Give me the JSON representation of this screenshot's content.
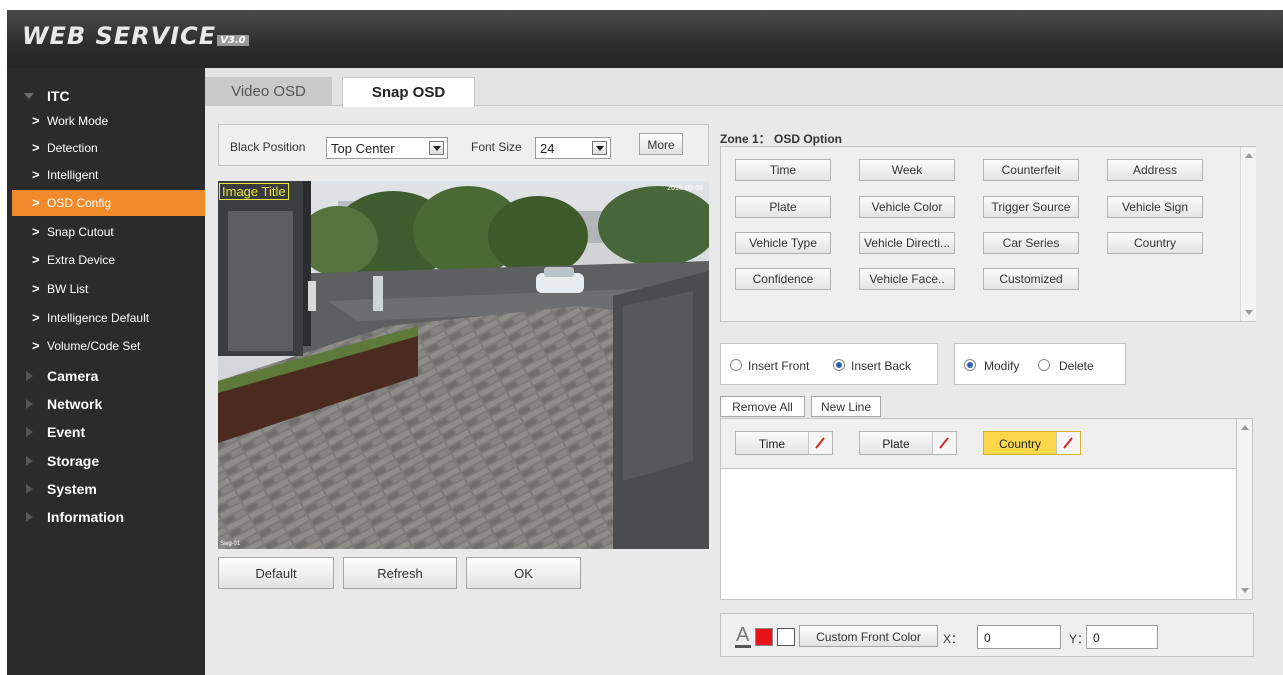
{
  "app": {
    "title": "WEB SERVICE",
    "version": "V3.0"
  },
  "sidebar": {
    "itc": {
      "label": "ITC"
    },
    "sub_items": [
      {
        "label": "Work Mode"
      },
      {
        "label": "Detection"
      },
      {
        "label": "Intelligent"
      },
      {
        "label": "OSD Config"
      },
      {
        "label": "Snap Cutout"
      },
      {
        "label": "Extra Device"
      },
      {
        "label": "BW List"
      },
      {
        "label": "Intelligence Default"
      },
      {
        "label": "Volume/Code Set"
      }
    ],
    "top_items": [
      {
        "label": "Camera"
      },
      {
        "label": "Network"
      },
      {
        "label": "Event"
      },
      {
        "label": "Storage"
      },
      {
        "label": "System"
      },
      {
        "label": "Information"
      }
    ],
    "active_item": "OSD Config"
  },
  "tabs": {
    "video_osd": "Video OSD",
    "snap_osd": "Snap OSD",
    "active": "Snap OSD"
  },
  "controls": {
    "black_position_label": "Black Position",
    "black_position_value": "Top Center",
    "font_size_label": "Font Size",
    "font_size_value": "24",
    "more_button": "More"
  },
  "preview": {
    "overlay_title": "Image Title",
    "timestamp_overlay": "2018-08-08",
    "bottom_left_overlay": "Swg-01"
  },
  "bottom_buttons": {
    "default": "Default",
    "refresh": "Refresh",
    "ok": "OK"
  },
  "zone": {
    "title": "Zone 1： OSD Option",
    "options": [
      "Time",
      "Week",
      "Counterfeit",
      "Address",
      "Plate",
      "Vehicle Color",
      "Trigger Source",
      "Vehicle Sign",
      "Vehicle Type",
      "Vehicle Directi...",
      "Car Series",
      "Country",
      "Confidence",
      "Vehicle Face..",
      "Customized"
    ]
  },
  "insert": {
    "front": "Insert Front",
    "back": "Insert Back",
    "selected": "Insert Back"
  },
  "edit_mode": {
    "modify": "Modify",
    "delete": "Delete",
    "selected": "Modify"
  },
  "line_buttons": {
    "remove_all": "Remove All",
    "new_line": "New Line"
  },
  "selected_items": [
    {
      "label": "Time",
      "highlighted": false
    },
    {
      "label": "Plate",
      "highlighted": false
    },
    {
      "label": "Country",
      "highlighted": true
    }
  ],
  "color": {
    "font_letter": "A",
    "front_color": "#e8121a",
    "back_color": "#ffffff",
    "custom_button": "Custom Front Color",
    "x_label": "X：",
    "x_value": "0",
    "y_label": "Y：",
    "y_value": "0"
  },
  "colors": {
    "accent": "#f08a2b",
    "highlight": "#fbd84a",
    "sidebar_bg": "#2b2b2b"
  }
}
